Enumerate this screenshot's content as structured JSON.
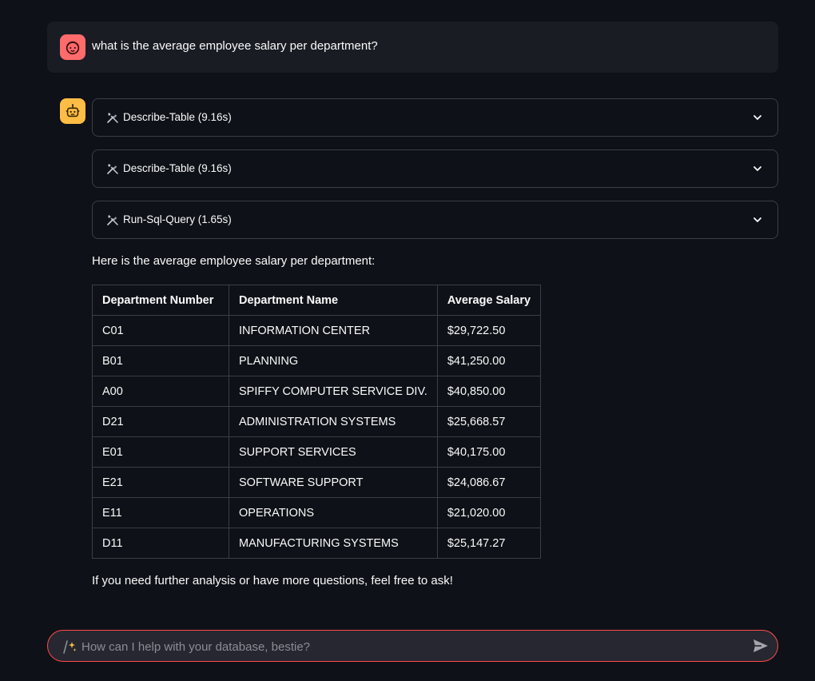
{
  "user_message": {
    "avatar_icon": "user-face-icon",
    "text": "what is the average employee salary per department?"
  },
  "assistant": {
    "avatar_icon": "robot-icon",
    "tool_calls": [
      {
        "label": "Describe-Table (9.16s)",
        "icon": "tools-icon",
        "expanded": false
      },
      {
        "label": "Describe-Table (9.16s)",
        "icon": "tools-icon",
        "expanded": false
      },
      {
        "label": "Run-Sql-Query (1.65s)",
        "icon": "tools-icon",
        "expanded": false
      }
    ],
    "intro": "Here is the average employee salary per department:",
    "table": {
      "headers": [
        "Department Number",
        "Department Name",
        "Average Salary"
      ],
      "rows": [
        [
          "C01",
          "INFORMATION CENTER",
          "$29,722.50"
        ],
        [
          "B01",
          "PLANNING",
          "$41,250.00"
        ],
        [
          "A00",
          "SPIFFY COMPUTER SERVICE DIV.",
          "$40,850.00"
        ],
        [
          "D21",
          "ADMINISTRATION SYSTEMS",
          "$25,668.57"
        ],
        [
          "E01",
          "SUPPORT SERVICES",
          "$40,175.00"
        ],
        [
          "E21",
          "SOFTWARE SUPPORT",
          "$24,086.67"
        ],
        [
          "E11",
          "OPERATIONS",
          "$21,020.00"
        ],
        [
          "D11",
          "MANUFACTURING SYSTEMS",
          "$25,147.27"
        ]
      ]
    },
    "outro": "If you need further analysis or have more questions, feel free to ask!"
  },
  "chat_input": {
    "placeholder": "How can I help with your database, bestie?",
    "value": "",
    "icon": "sparkle-wand-icon",
    "send_icon": "send-icon"
  },
  "colors": {
    "background": "#0e1117",
    "user_bubble": "#1a1c24",
    "user_avatar": "#ff6b6b",
    "bot_avatar": "#ffbd45",
    "border": "#3b3e48",
    "input_border": "#ff4b4b"
  }
}
